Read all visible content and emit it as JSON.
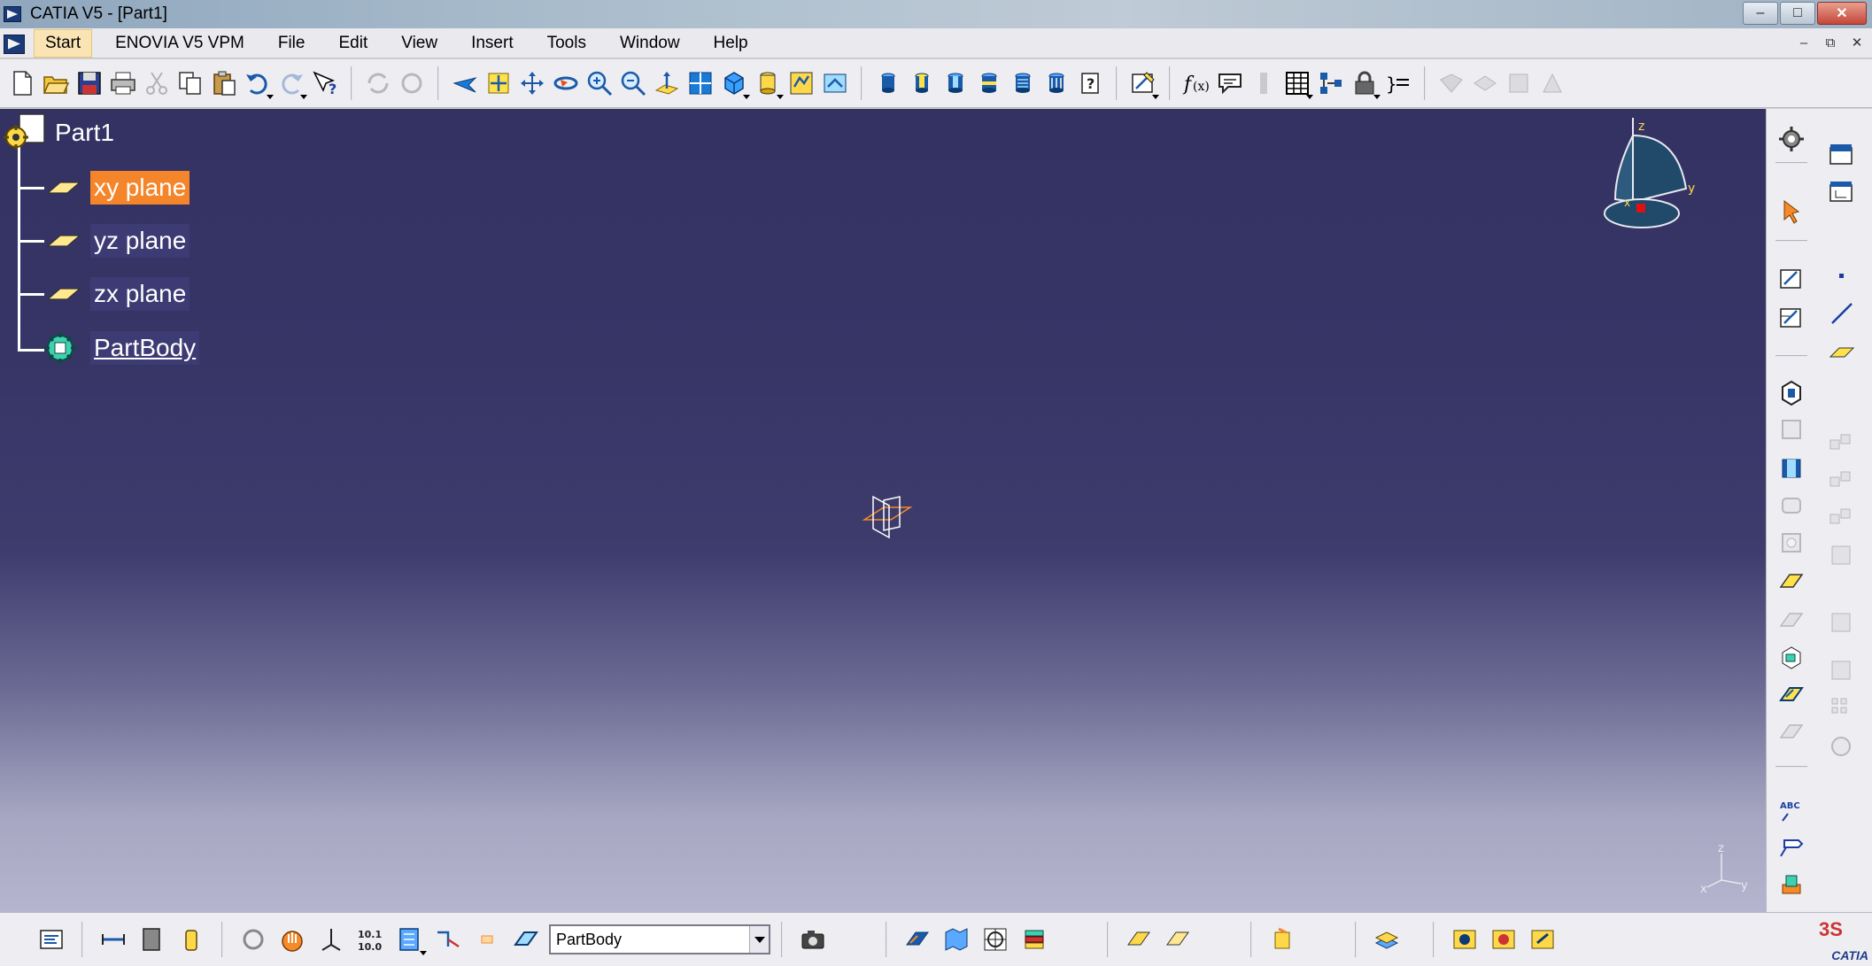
{
  "window": {
    "title": "CATIA V5 - [Part1]",
    "minimize": "–",
    "maximize": "□",
    "close": "✕"
  },
  "menubar": {
    "items": [
      {
        "label": "Start"
      },
      {
        "label": "ENOVIA V5 VPM"
      },
      {
        "label": "File"
      },
      {
        "label": "Edit"
      },
      {
        "label": "View"
      },
      {
        "label": "Insert"
      },
      {
        "label": "Tools"
      },
      {
        "label": "Window"
      },
      {
        "label": "Help"
      }
    ],
    "mdi_minimize": "–",
    "mdi_restore": "⧉",
    "mdi_close": "✕"
  },
  "tree": {
    "root": "Part1",
    "nodes": [
      {
        "label": "xy plane",
        "selected": true
      },
      {
        "label": "yz plane",
        "selected": false
      },
      {
        "label": "zx plane",
        "selected": false
      },
      {
        "label": "PartBody",
        "selected": false
      }
    ]
  },
  "compass": {
    "x": "x",
    "y": "y",
    "z": "z"
  },
  "mini_axis": {
    "x": "x",
    "y": "y",
    "z": "z"
  },
  "bottom": {
    "current_body": "PartBody"
  },
  "logo": {
    "text": "CATIA"
  },
  "colors": {
    "selection": "#f5852a",
    "background_top": "#343262",
    "background_bottom": "#b5b5cf",
    "toolbar": "#eeeef2"
  },
  "icons": {
    "top_toolbar": [
      "new-icon",
      "open-icon",
      "save-icon",
      "print-icon",
      "cut-icon",
      "copy-icon",
      "paste-icon",
      "undo-icon",
      "redo-icon",
      "whats-this-icon",
      "update-icon",
      "fly-mode-icon",
      "fit-all-icon",
      "pan-icon",
      "rotate-icon",
      "zoom-in-icon",
      "zoom-out-icon",
      "normal-view-icon",
      "multi-view-icon",
      "iso-view-icon",
      "shading-icon",
      "hide-show-icon",
      "swap-space-icon",
      "pad-icon",
      "pocket-icon",
      "shaft-icon",
      "groove-icon",
      "hole-icon",
      "rib-icon",
      "slot-icon",
      "sketch-icon",
      "formula-icon",
      "annotation-icon",
      "knowledge-icon",
      "table-icon",
      "tree-icon",
      "lock-icon",
      "parameters-icon"
    ],
    "right_toolbar": [
      "gear-icon",
      "select-arrow-icon",
      "sketcher-icon",
      "point-icon",
      "line-icon",
      "plane-icon"
    ],
    "bottom_toolbar": [
      "properties-icon",
      "measure-icon",
      "apply-material-icon",
      "axis-system-icon",
      "snap-icon",
      "hand-icon",
      "axis-icon",
      "grid-icon",
      "catalog-icon",
      "plane-icon",
      "body-icon",
      "camera-icon"
    ]
  }
}
